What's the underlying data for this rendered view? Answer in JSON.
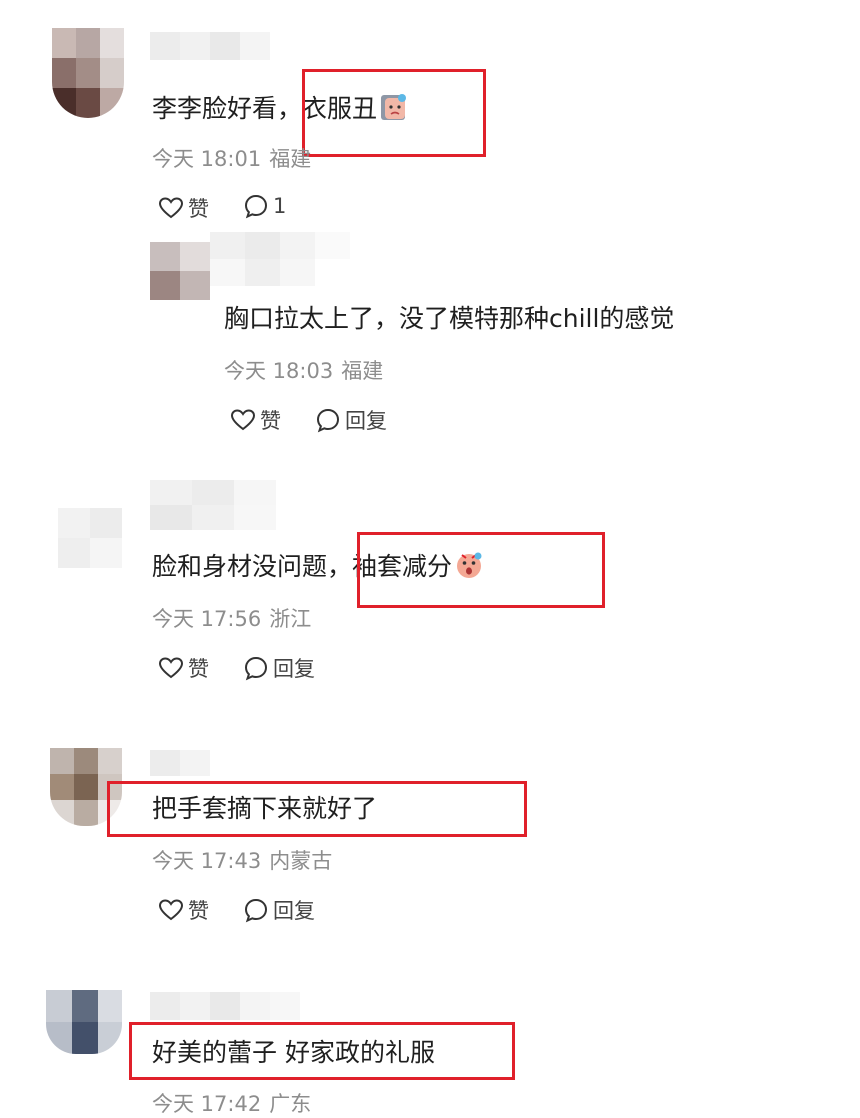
{
  "comments": [
    {
      "text_prefix": "李李脸好看，",
      "text_highlight": "衣服丑",
      "emoji": "cry-face-emoji",
      "time": "今天 18:01",
      "location": "福建",
      "like_label": "赞",
      "reply_count": "1"
    },
    {
      "text": "胸口拉太上了，没了模特那种chill的感觉",
      "time": "今天 18:03",
      "location": "福建",
      "like_label": "赞",
      "reply_label": "回复"
    },
    {
      "text_prefix": "脸和身材没问题，",
      "text_highlight": "袖套减分",
      "emoji": "shocked-face-emoji",
      "time": "今天 17:56",
      "location": "浙江",
      "like_label": "赞",
      "reply_label": "回复"
    },
    {
      "text": "把手套摘下来就好了",
      "time": "今天 17:43",
      "location": "内蒙古",
      "like_label": "赞",
      "reply_label": "回复"
    },
    {
      "text": "好美的蕾子 好家政的礼服",
      "time": "今天 17:42",
      "location": "广东"
    }
  ],
  "colors": {
    "highlight_border": "#e0202a",
    "meta_text": "#8d8d8d",
    "body_text": "#1f1f1f"
  }
}
